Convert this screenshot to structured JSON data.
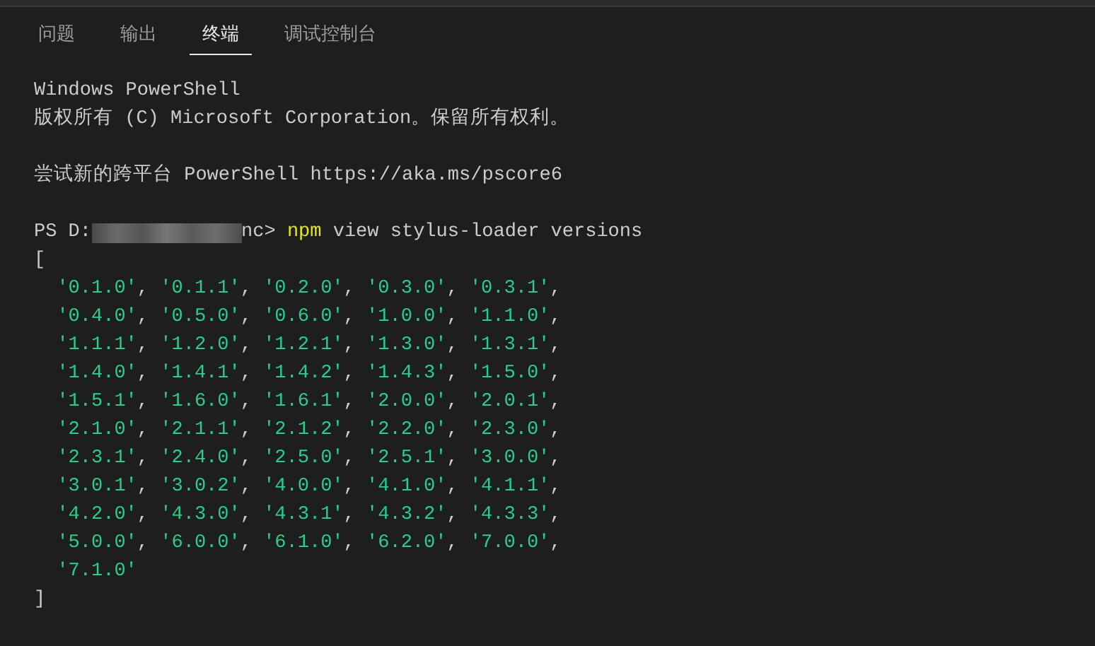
{
  "tabs": [
    {
      "label": "问题",
      "selected": false
    },
    {
      "label": "输出",
      "selected": false
    },
    {
      "label": "终端",
      "selected": true
    },
    {
      "label": "调试控制台",
      "selected": false
    }
  ],
  "terminal": {
    "banner": [
      "Windows PowerShell",
      "版权所有 (C) Microsoft Corporation。保留所有权利。"
    ],
    "hint": "尝试新的跨平台 PowerShell https://aka.ms/pscore6",
    "prompt": {
      "prefix": "PS D:",
      "suffix": "nc>",
      "command": "npm",
      "args": "view stylus-loader versions"
    },
    "output_lines": [
      "[",
      "  '0.1.0', '0.1.1', '0.2.0', '0.3.0', '0.3.1',",
      "  '0.4.0', '0.5.0', '0.6.0', '1.0.0', '1.1.0',",
      "  '1.1.1', '1.2.0', '1.2.1', '1.3.0', '1.3.1',",
      "  '1.4.0', '1.4.1', '1.4.2', '1.4.3', '1.5.0',",
      "  '1.5.1', '1.6.0', '1.6.1', '2.0.0', '2.0.1',",
      "  '2.1.0', '2.1.1', '2.1.2', '2.2.0', '2.3.0',",
      "  '2.3.1', '2.4.0', '2.5.0', '2.5.1', '3.0.0',",
      "  '3.0.1', '3.0.2', '4.0.0', '4.1.0', '4.1.1',",
      "  '4.2.0', '4.3.0', '4.3.1', '4.3.2', '4.3.3',",
      "  '5.0.0', '6.0.0', '6.1.0', '6.2.0', '7.0.0',",
      "  '7.1.0'",
      "]"
    ]
  }
}
